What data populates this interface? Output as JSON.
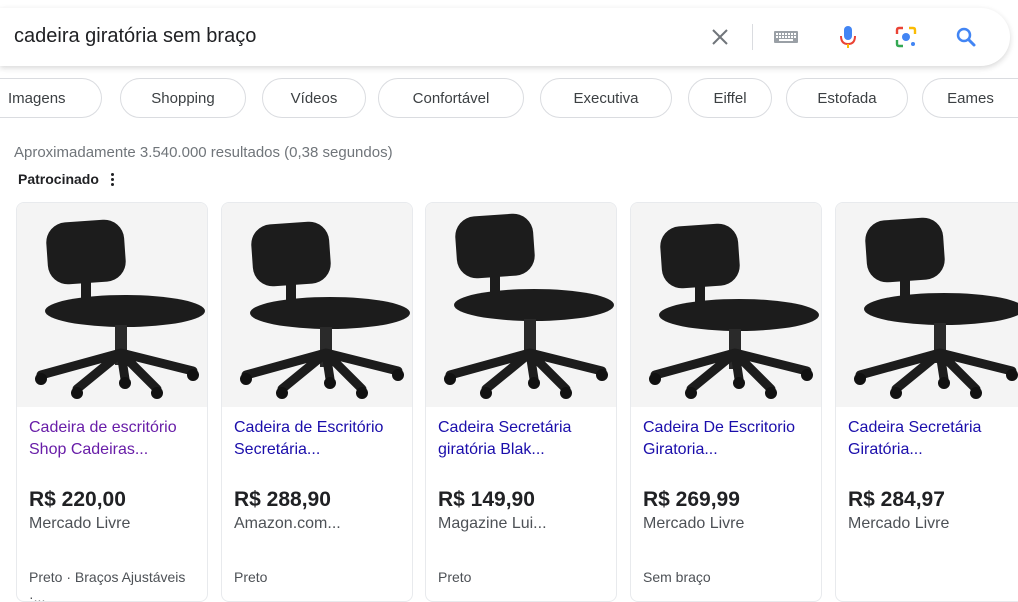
{
  "search": {
    "query": "cadeira giratória sem braço",
    "icons": [
      "clear-icon",
      "keyboard-icon",
      "microphone-icon",
      "lens-icon",
      "search-icon"
    ]
  },
  "chips": [
    "Imagens",
    "Shopping",
    "Vídeos",
    "Confortável",
    "Executiva",
    "Eiffel",
    "Estofada",
    "Eames"
  ],
  "results_count": "Aproximadamente 3.540.000 resultados (0,38 segundos)",
  "sponsored_label": "Patrocinado",
  "colors": {
    "link": "#1a0dab",
    "visited": "#681da8",
    "mic": "#4285f4",
    "chair": "#1c1c1c"
  },
  "products": [
    {
      "title": "Cadeira de escritório Shop Cadeiras...",
      "price": "R$ 220,00",
      "store": "Mercado Livre",
      "detail": "Preto · Braços Ajustáveis ·...",
      "visited": true
    },
    {
      "title": "Cadeira de Escritório Secretária...",
      "price": "R$ 288,90",
      "store": "Amazon.com...",
      "detail": "Preto",
      "visited": false
    },
    {
      "title": "Cadeira Secretária giratória Blak...",
      "price": "R$ 149,90",
      "store": "Magazine Lui...",
      "detail": "Preto",
      "visited": false
    },
    {
      "title": "Cadeira De Escritorio Giratoria...",
      "price": "R$ 269,99",
      "store": "Mercado Livre",
      "detail": "Sem braço",
      "visited": false
    },
    {
      "title": "Cadeira Secretária Giratória...",
      "price": "R$ 284,97",
      "store": "Mercado Livre",
      "detail": "",
      "visited": false
    }
  ]
}
